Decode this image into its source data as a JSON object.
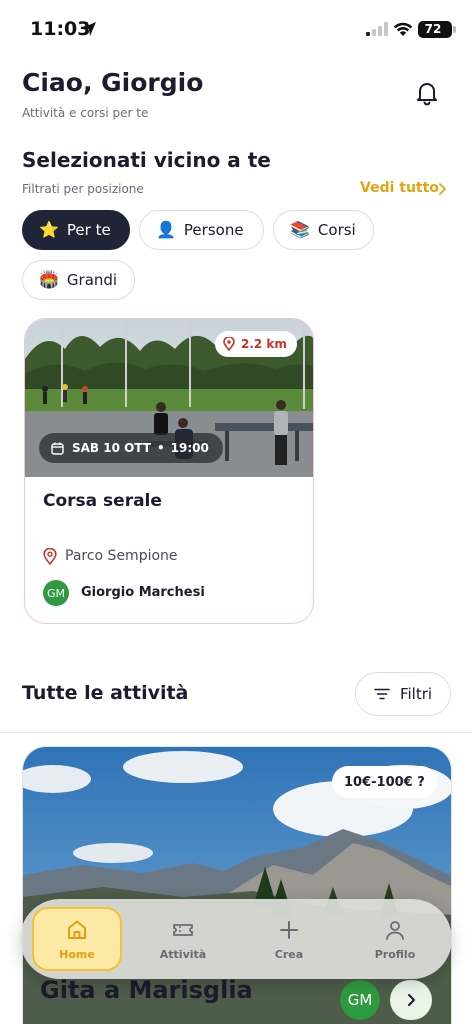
{
  "status_bar": {
    "time": "11:03",
    "battery": "72"
  },
  "header": {
    "greeting": "Ciao, Giorgio",
    "subtitle": "Attività e corsi per te"
  },
  "nearby": {
    "title": "Selezionati vicino a te",
    "subtitle": "Filtrati per posizione",
    "see_all": "Vedi tutto",
    "chips": [
      {
        "label": "Per te",
        "icon": "⭐",
        "active": true
      },
      {
        "label": "Persone",
        "icon": "👤",
        "active": false
      },
      {
        "label": "Corsi",
        "icon": "📚",
        "active": false
      },
      {
        "label": "Grandi",
        "icon": "🏟️",
        "active": false
      }
    ],
    "card": {
      "distance": "2.2 km",
      "date": "SAB 10 OTT",
      "time": "19:00",
      "title": "Corsa serale",
      "place": "Parco Sempione",
      "organizer_initials": "GM",
      "organizer": "Giorgio Marchesi"
    }
  },
  "all_activities": {
    "title": "Tutte le attività",
    "filter_label": "Filtri",
    "card": {
      "price": "10€-100€ ?",
      "title": "Gita a Marisglia",
      "organizer_initials": "GM"
    }
  },
  "tabbar": {
    "items": [
      {
        "label": "Home",
        "icon": "home-icon",
        "active": true
      },
      {
        "label": "Attività",
        "icon": "ticket-icon",
        "active": false
      },
      {
        "label": "Crea",
        "icon": "plus-icon",
        "active": false
      },
      {
        "label": "Profilo",
        "icon": "user-icon",
        "active": false
      }
    ]
  },
  "colors": {
    "accent": "#e3a410",
    "dark": "#1f2437",
    "avatar": "#2e9a3f",
    "distance": "#c9332e"
  }
}
